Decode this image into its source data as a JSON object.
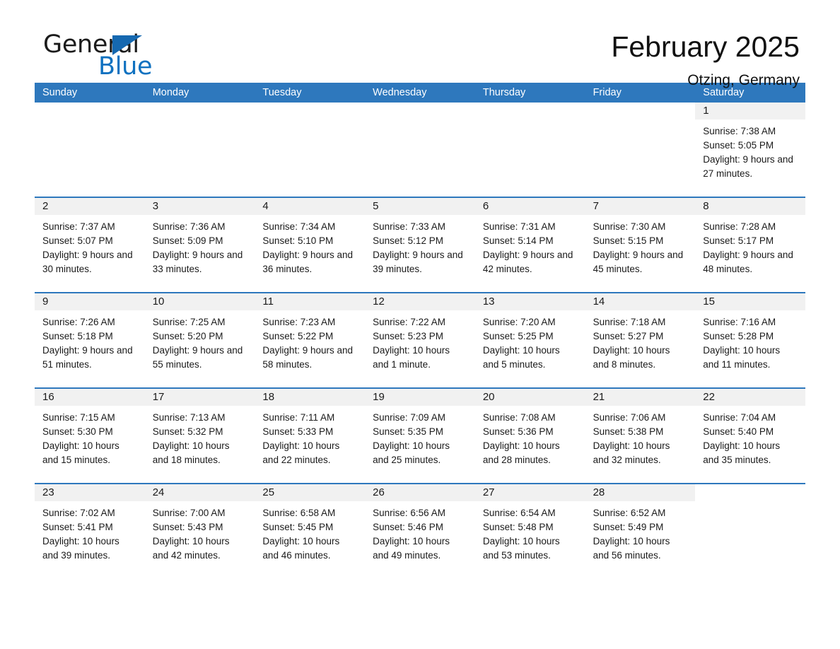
{
  "brand": {
    "logo_text_primary": "General",
    "logo_text_secondary": "Blue",
    "accent_color": "#2e78bd",
    "logo_blue": "#0f71c0"
  },
  "header": {
    "title": "February 2025",
    "subtitle": "Otzing, Germany"
  },
  "calendar": {
    "weekday_headers": [
      "Sunday",
      "Monday",
      "Tuesday",
      "Wednesday",
      "Thursday",
      "Friday",
      "Saturday"
    ],
    "weeks": [
      [
        {
          "day": "",
          "sunrise": "",
          "sunset": "",
          "daylight": ""
        },
        {
          "day": "",
          "sunrise": "",
          "sunset": "",
          "daylight": ""
        },
        {
          "day": "",
          "sunrise": "",
          "sunset": "",
          "daylight": ""
        },
        {
          "day": "",
          "sunrise": "",
          "sunset": "",
          "daylight": ""
        },
        {
          "day": "",
          "sunrise": "",
          "sunset": "",
          "daylight": ""
        },
        {
          "day": "",
          "sunrise": "",
          "sunset": "",
          "daylight": ""
        },
        {
          "day": "1",
          "sunrise": "Sunrise: 7:38 AM",
          "sunset": "Sunset: 5:05 PM",
          "daylight": "Daylight: 9 hours and 27 minutes."
        }
      ],
      [
        {
          "day": "2",
          "sunrise": "Sunrise: 7:37 AM",
          "sunset": "Sunset: 5:07 PM",
          "daylight": "Daylight: 9 hours and 30 minutes."
        },
        {
          "day": "3",
          "sunrise": "Sunrise: 7:36 AM",
          "sunset": "Sunset: 5:09 PM",
          "daylight": "Daylight: 9 hours and 33 minutes."
        },
        {
          "day": "4",
          "sunrise": "Sunrise: 7:34 AM",
          "sunset": "Sunset: 5:10 PM",
          "daylight": "Daylight: 9 hours and 36 minutes."
        },
        {
          "day": "5",
          "sunrise": "Sunrise: 7:33 AM",
          "sunset": "Sunset: 5:12 PM",
          "daylight": "Daylight: 9 hours and 39 minutes."
        },
        {
          "day": "6",
          "sunrise": "Sunrise: 7:31 AM",
          "sunset": "Sunset: 5:14 PM",
          "daylight": "Daylight: 9 hours and 42 minutes."
        },
        {
          "day": "7",
          "sunrise": "Sunrise: 7:30 AM",
          "sunset": "Sunset: 5:15 PM",
          "daylight": "Daylight: 9 hours and 45 minutes."
        },
        {
          "day": "8",
          "sunrise": "Sunrise: 7:28 AM",
          "sunset": "Sunset: 5:17 PM",
          "daylight": "Daylight: 9 hours and 48 minutes."
        }
      ],
      [
        {
          "day": "9",
          "sunrise": "Sunrise: 7:26 AM",
          "sunset": "Sunset: 5:18 PM",
          "daylight": "Daylight: 9 hours and 51 minutes."
        },
        {
          "day": "10",
          "sunrise": "Sunrise: 7:25 AM",
          "sunset": "Sunset: 5:20 PM",
          "daylight": "Daylight: 9 hours and 55 minutes."
        },
        {
          "day": "11",
          "sunrise": "Sunrise: 7:23 AM",
          "sunset": "Sunset: 5:22 PM",
          "daylight": "Daylight: 9 hours and 58 minutes."
        },
        {
          "day": "12",
          "sunrise": "Sunrise: 7:22 AM",
          "sunset": "Sunset: 5:23 PM",
          "daylight": "Daylight: 10 hours and 1 minute."
        },
        {
          "day": "13",
          "sunrise": "Sunrise: 7:20 AM",
          "sunset": "Sunset: 5:25 PM",
          "daylight": "Daylight: 10 hours and 5 minutes."
        },
        {
          "day": "14",
          "sunrise": "Sunrise: 7:18 AM",
          "sunset": "Sunset: 5:27 PM",
          "daylight": "Daylight: 10 hours and 8 minutes."
        },
        {
          "day": "15",
          "sunrise": "Sunrise: 7:16 AM",
          "sunset": "Sunset: 5:28 PM",
          "daylight": "Daylight: 10 hours and 11 minutes."
        }
      ],
      [
        {
          "day": "16",
          "sunrise": "Sunrise: 7:15 AM",
          "sunset": "Sunset: 5:30 PM",
          "daylight": "Daylight: 10 hours and 15 minutes."
        },
        {
          "day": "17",
          "sunrise": "Sunrise: 7:13 AM",
          "sunset": "Sunset: 5:32 PM",
          "daylight": "Daylight: 10 hours and 18 minutes."
        },
        {
          "day": "18",
          "sunrise": "Sunrise: 7:11 AM",
          "sunset": "Sunset: 5:33 PM",
          "daylight": "Daylight: 10 hours and 22 minutes."
        },
        {
          "day": "19",
          "sunrise": "Sunrise: 7:09 AM",
          "sunset": "Sunset: 5:35 PM",
          "daylight": "Daylight: 10 hours and 25 minutes."
        },
        {
          "day": "20",
          "sunrise": "Sunrise: 7:08 AM",
          "sunset": "Sunset: 5:36 PM",
          "daylight": "Daylight: 10 hours and 28 minutes."
        },
        {
          "day": "21",
          "sunrise": "Sunrise: 7:06 AM",
          "sunset": "Sunset: 5:38 PM",
          "daylight": "Daylight: 10 hours and 32 minutes."
        },
        {
          "day": "22",
          "sunrise": "Sunrise: 7:04 AM",
          "sunset": "Sunset: 5:40 PM",
          "daylight": "Daylight: 10 hours and 35 minutes."
        }
      ],
      [
        {
          "day": "23",
          "sunrise": "Sunrise: 7:02 AM",
          "sunset": "Sunset: 5:41 PM",
          "daylight": "Daylight: 10 hours and 39 minutes."
        },
        {
          "day": "24",
          "sunrise": "Sunrise: 7:00 AM",
          "sunset": "Sunset: 5:43 PM",
          "daylight": "Daylight: 10 hours and 42 minutes."
        },
        {
          "day": "25",
          "sunrise": "Sunrise: 6:58 AM",
          "sunset": "Sunset: 5:45 PM",
          "daylight": "Daylight: 10 hours and 46 minutes."
        },
        {
          "day": "26",
          "sunrise": "Sunrise: 6:56 AM",
          "sunset": "Sunset: 5:46 PM",
          "daylight": "Daylight: 10 hours and 49 minutes."
        },
        {
          "day": "27",
          "sunrise": "Sunrise: 6:54 AM",
          "sunset": "Sunset: 5:48 PM",
          "daylight": "Daylight: 10 hours and 53 minutes."
        },
        {
          "day": "28",
          "sunrise": "Sunrise: 6:52 AM",
          "sunset": "Sunset: 5:49 PM",
          "daylight": "Daylight: 10 hours and 56 minutes."
        },
        {
          "day": "",
          "sunrise": "",
          "sunset": "",
          "daylight": ""
        }
      ]
    ]
  }
}
